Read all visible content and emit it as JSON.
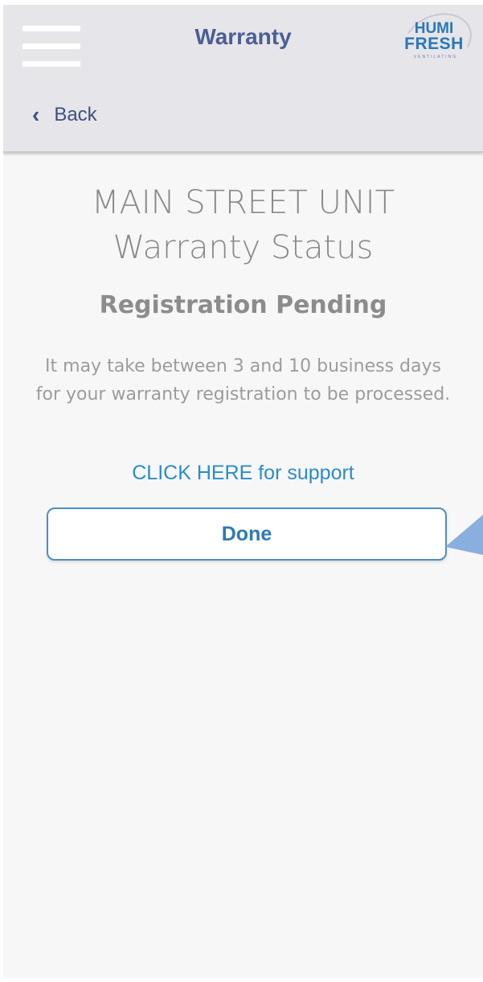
{
  "header": {
    "title": "Warranty",
    "back_label": "Back",
    "logo": {
      "line1": "HUMI",
      "line2": "FRESH",
      "line3": "VENTILATING"
    }
  },
  "main": {
    "unit_name": "MAIN STREET UNIT",
    "page_heading": "Warranty Status",
    "status": "Registration Pending",
    "description": "It may take between 3 and 10 business days for your warranty registration to be processed.",
    "support_link": "CLICK HERE for support",
    "done_label": "Done"
  },
  "colors": {
    "header_bg": "#e6e5ea",
    "title": "#4a5f93",
    "link": "#2a8ccc",
    "button_border": "#4c8fc4",
    "pointer": "#8aaede"
  },
  "icons": {
    "menu": "hamburger-menu-icon",
    "back": "chevron-left-icon",
    "pointer": "callout-pointer-icon"
  }
}
